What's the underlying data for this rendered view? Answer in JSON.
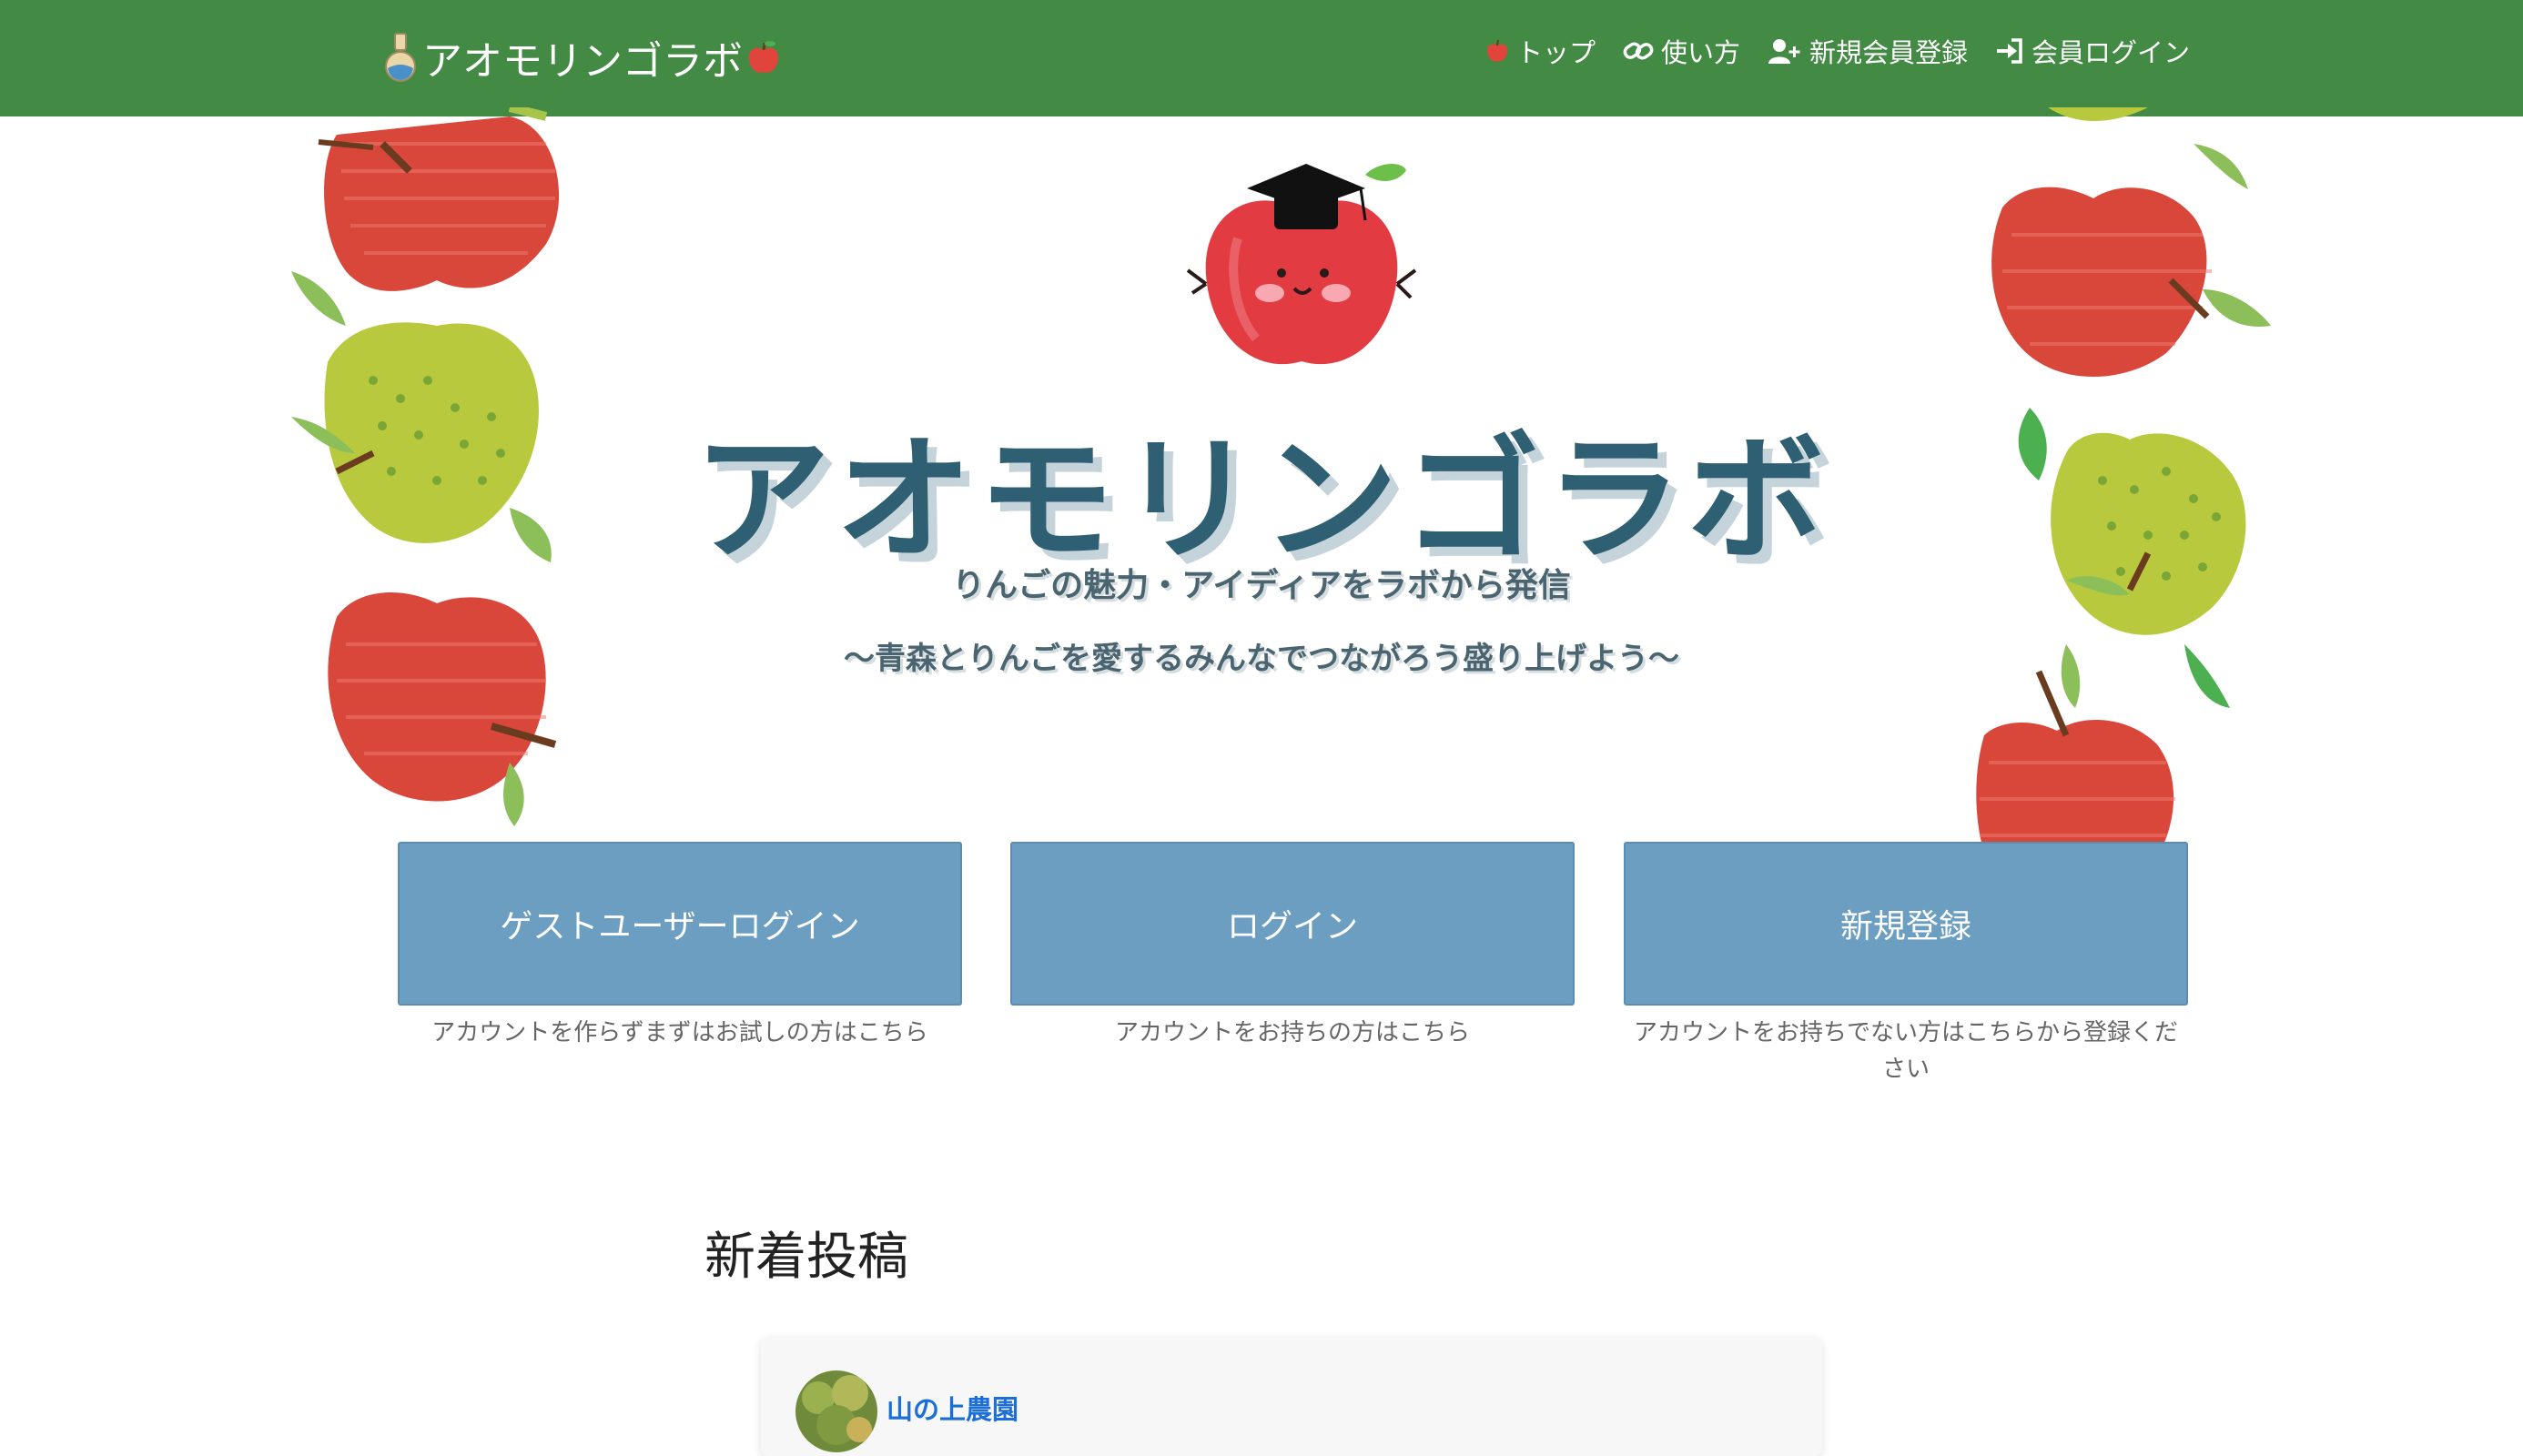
{
  "navbar": {
    "brand": "アオモリンゴラボ",
    "links": [
      {
        "label": "トップ",
        "icon": "apple-icon"
      },
      {
        "label": "使い方",
        "icon": "link-icon"
      },
      {
        "label": "新規会員登録",
        "icon": "user-plus-icon"
      },
      {
        "label": "会員ログイン",
        "icon": "sign-in-icon"
      }
    ]
  },
  "hero": {
    "title": "アオモリンゴラボ",
    "subtitle": "りんごの魅力・アイディアをラボから発信",
    "catchphrase": "〜青森とりんごを愛するみんなでつながろう盛り上げよう〜"
  },
  "actions": [
    {
      "label": "ゲストユーザーログイン",
      "note": "アカウントを作らずまずはお試しの方はこちら"
    },
    {
      "label": "ログイン",
      "note": "アカウントをお持ちの方はこちら"
    },
    {
      "label": "新規登録",
      "note": "アカウントをお持ちでない方はこちらから登録ください"
    }
  ],
  "new_posts": {
    "heading": "新着投稿",
    "posts": [
      {
        "author": "山の上農園"
      }
    ]
  },
  "colors": {
    "navbar": "#438a44",
    "action_button": "#6b9ec1",
    "title": "#2f5f72",
    "link": "#1c6fd6",
    "red_apple": "#d9473a",
    "green_apple": "#b8c93e"
  }
}
